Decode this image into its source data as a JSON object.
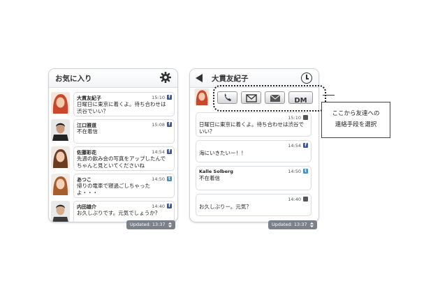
{
  "favorites": {
    "title": "お気に入り",
    "footer": "Updated: 13:37",
    "items": [
      {
        "name": "大貫友紀子",
        "time": "15:10",
        "service": "f",
        "message": "日曜日に東京に着くよ。待ち合わせは渋谷でいい？"
      },
      {
        "name": "江口雅道",
        "time": "15:08",
        "service": "f",
        "message": "不在着信"
      },
      {
        "name": "佐藤彩花",
        "time": "14:54",
        "service": "f",
        "message": "先週の飲み会の写真をアップしたんでちゃんと見といてくださいね"
      },
      {
        "name": "あつこ",
        "time": "14:50",
        "service": "t",
        "message": "帰りの電車で寝過ごしちゃったよ・・・"
      },
      {
        "name": "内田雄介",
        "time": "14:40",
        "service": "f",
        "message": "お久しぶりです。元気でしょうか？"
      }
    ]
  },
  "conversation": {
    "title": "大貫友紀子",
    "footer": "Updated: 13:37",
    "contact_buttons": {
      "phone": "phone-icon",
      "mail": "mail-icon",
      "sms": "SMS",
      "dm": "DM"
    },
    "messages": [
      {
        "sender": "",
        "time": "15:10",
        "service": "mail",
        "text": "日曜日に東京に着くよ。待ち合わせは渋谷でいい？"
      },
      {
        "sender": "",
        "time": "14:54",
        "service": "f",
        "text": "海にいきたいー！！"
      },
      {
        "sender": "Kalle Solberg",
        "time": "14:50",
        "service": "t",
        "text": "不在着信"
      },
      {
        "sender": "",
        "time": "14:40",
        "service": "mail",
        "text": "お久しぶりー。元気？"
      }
    ]
  },
  "callout": {
    "line1": "ここから友達への",
    "line2": "連絡手段を選択"
  },
  "colors": {
    "facebook": "#3b5998",
    "footer": "#7b8089"
  }
}
